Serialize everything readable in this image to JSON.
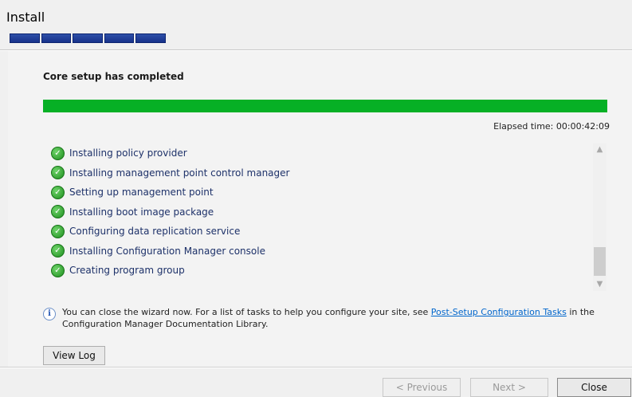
{
  "window": {
    "title": "Install",
    "step_segments": 5
  },
  "status": {
    "heading": "Core setup has completed",
    "progress_percent": 100,
    "progress_color": "#06b025",
    "elapsed": "Elapsed time: 00:00:42:09"
  },
  "tasks": [
    {
      "label": "Installing policy provider",
      "icon": "check-icon"
    },
    {
      "label": "Installing management point control manager",
      "icon": "check-icon"
    },
    {
      "label": "Setting up management point",
      "icon": "check-icon"
    },
    {
      "label": "Installing boot image package",
      "icon": "check-icon"
    },
    {
      "label": "Configuring data replication service",
      "icon": "check-icon"
    },
    {
      "label": "Installing Configuration Manager console",
      "icon": "check-icon"
    },
    {
      "label": "Creating program group",
      "icon": "check-icon"
    }
  ],
  "info": {
    "text_before": "You can close the wizard now. For a list of tasks to help you configure your site, see ",
    "link": "Post-Setup Configuration Tasks",
    "text_after": " in the Configuration Manager Documentation Library.",
    "icon": "info-icon"
  },
  "buttons": {
    "view_log": "View Log",
    "previous": "< Previous",
    "next": "Next >",
    "close": "Close"
  }
}
